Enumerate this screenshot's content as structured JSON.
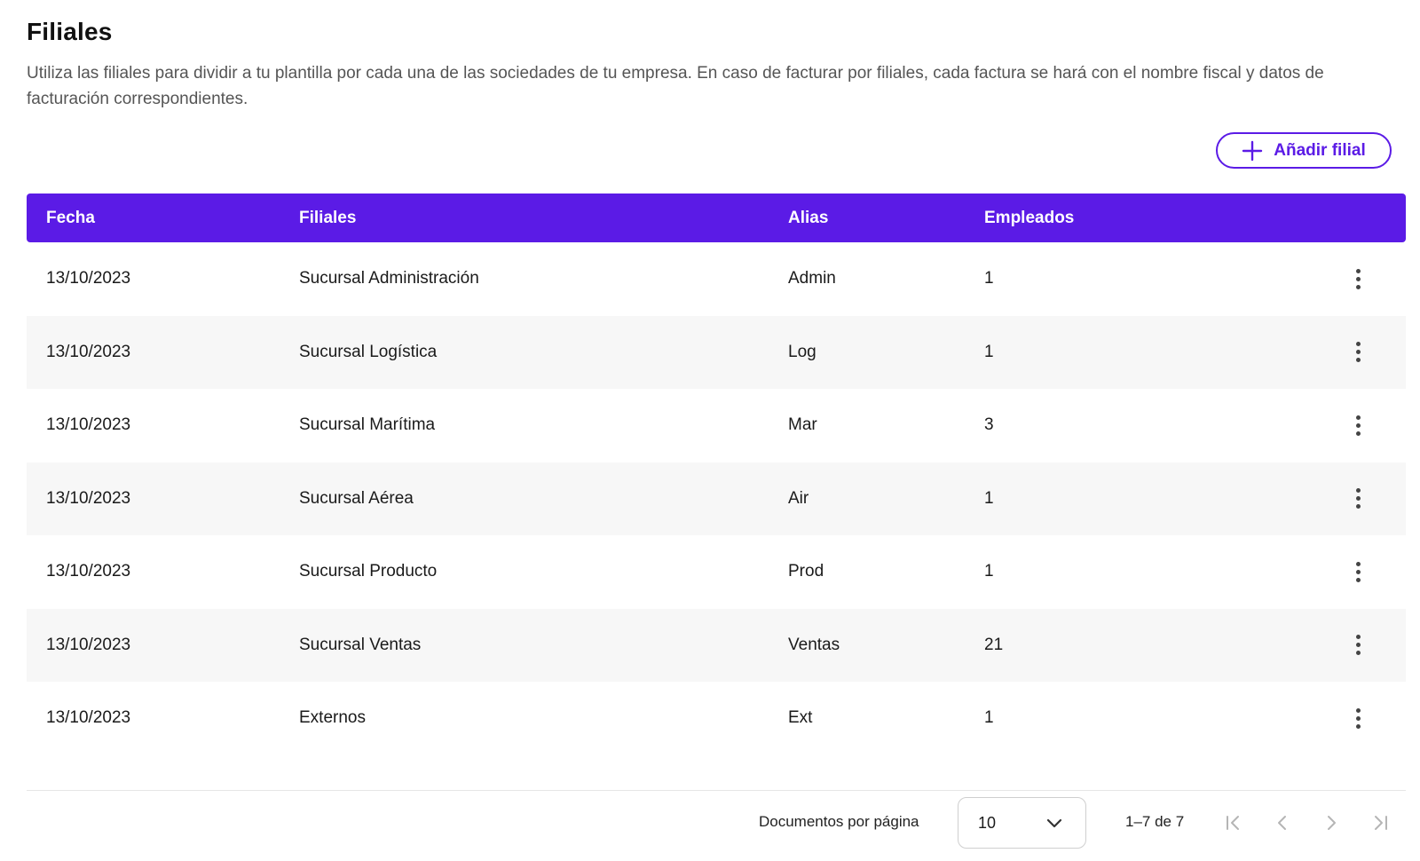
{
  "page": {
    "title": "Filiales",
    "description": "Utiliza las filiales para dividir a tu plantilla por cada una de las sociedades de tu empresa. En caso de facturar por filiales, cada factura se hará con el nombre fiscal y datos de facturación correspondientes.",
    "add_button_label": "Añadir filial"
  },
  "table": {
    "headers": [
      "Fecha",
      "Filiales",
      "Alias",
      "Empleados"
    ],
    "rows": [
      {
        "fecha": "13/10/2023",
        "filial": "Sucursal Administración",
        "alias": "Admin",
        "empleados": "1"
      },
      {
        "fecha": "13/10/2023",
        "filial": "Sucursal Logística",
        "alias": "Log",
        "empleados": "1"
      },
      {
        "fecha": "13/10/2023",
        "filial": "Sucursal Marítima",
        "alias": "Mar",
        "empleados": "3"
      },
      {
        "fecha": "13/10/2023",
        "filial": "Sucursal Aérea",
        "alias": "Air",
        "empleados": "1"
      },
      {
        "fecha": "13/10/2023",
        "filial": "Sucursal Producto",
        "alias": "Prod",
        "empleados": "1"
      },
      {
        "fecha": "13/10/2023",
        "filial": "Sucursal Ventas",
        "alias": "Ventas",
        "empleados": "21"
      },
      {
        "fecha": "13/10/2023",
        "filial": "Externos",
        "alias": "Ext",
        "empleados": "1"
      }
    ]
  },
  "pagination": {
    "per_page_label": "Documentos por página",
    "per_page_value": "10",
    "range_text": "1–7 de 7"
  },
  "icons": {
    "add": "plus-icon",
    "row_actions": "more-vertical-icon",
    "select": "chevron-down-icon",
    "first": "first-page-icon",
    "prev": "chevron-left-icon",
    "next": "chevron-right-icon",
    "last": "last-page-icon"
  },
  "colors": {
    "accent": "#5b1be6",
    "header_text": "#ffffff",
    "row_alt_bg": "#f7f7f7",
    "nav_disabled": "#b5b5b5"
  }
}
